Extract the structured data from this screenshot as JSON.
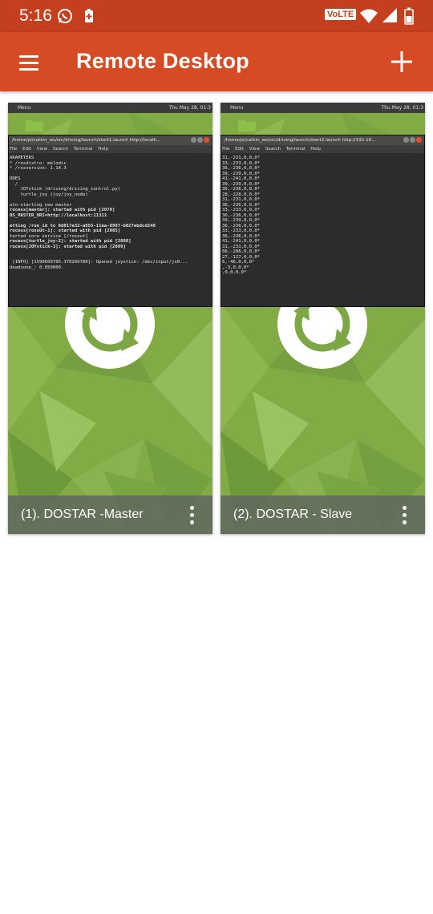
{
  "status_bar": {
    "time": "5:16",
    "icons": [
      "whatsapp-icon",
      "battery-saver-icon"
    ],
    "volte": "VoLTE",
    "right_icons": [
      "wifi-icon",
      "signal-icon",
      "battery-icon"
    ]
  },
  "app_bar": {
    "title": "Remote Desktop",
    "menu_icon": "hamburger-menu-icon",
    "add_icon": "plus-icon"
  },
  "desktops": [
    {
      "label": "(1).   DOSTAR -Master",
      "menu_icon": "more-vert-icon",
      "screen": {
        "top_left": "Menu",
        "top_right": "Thu May 28, 01:3",
        "terminal_title": "/home/pi/catkin_ws/src/driving/launch/start1.launch http://localh...",
        "terminal_menu": [
          "File",
          "Edit",
          "View",
          "Search",
          "Terminal",
          "Help"
        ],
        "lines": [
          {
            "t": "ARAMETERS",
            "s": ""
          },
          {
            "t": "* /rosdistro: melodic",
            "s": ""
          },
          {
            "t": "* /rosversion: 1.14.3",
            "s": ""
          },
          {
            "t": "",
            "s": ""
          },
          {
            "t": "ODES",
            "s": ""
          },
          {
            "t": "  /",
            "s": ""
          },
          {
            "t": "    JOYstick (driving/driving_control.py)",
            "s": ""
          },
          {
            "t": "    turtle_joy (joy/joy_node)",
            "s": ""
          },
          {
            "t": "",
            "s": ""
          },
          {
            "t": "uto-starting new master",
            "s": ""
          },
          {
            "t": "rocess[master]: started with pid [2070]",
            "s": "b"
          },
          {
            "t": "OS_MASTER_URI=http://localhost:11311",
            "s": "b"
          },
          {
            "t": "",
            "s": ""
          },
          {
            "t": "etting /run_id to 0d017e32-a055-11ea-8997-b027ebdcd240",
            "s": "b"
          },
          {
            "t": "rocess[rosout-1]: started with pid [2085]",
            "s": "b"
          },
          {
            "t": "tarted core service [/rosout]",
            "s": ""
          },
          {
            "t": "rocess[turtle_joy-2]: started with pid [2088]",
            "s": "b"
          },
          {
            "t": "rocess[JOYstick-3]: started with pid [2089]",
            "s": "b"
          },
          {
            "t": "",
            "s": "r"
          },
          {
            "t": "",
            "s": "r"
          },
          {
            "t": " [INFO] [1590609785.370266780]: Opened joystick: /dev/input/js0...",
            "s": ""
          },
          {
            "t": "deadzone_: 0.050000.",
            "s": ""
          }
        ]
      }
    },
    {
      "label": "(2).   DOSTAR - Slave",
      "menu_icon": "more-vert-icon",
      "screen": {
        "top_left": "Menu",
        "top_right": "Thu May 28, 01:3",
        "terminal_title": "/home/pi/catkin_ws/src/driving/launch/start2.launch http://192.16...",
        "terminal_menu": [
          "File",
          "Edit",
          "View",
          "Search",
          "Terminal",
          "Help"
        ],
        "lines": [
          {
            "t": "31,-231,0,0,0*",
            "s": ""
          },
          {
            "t": "33,-233,0,0,0*",
            "s": ""
          },
          {
            "t": "36,-236,0,0,0*",
            "s": ""
          },
          {
            "t": "39,-239,0,0,0*",
            "s": ""
          },
          {
            "t": "41,-241,0,0,0*",
            "s": ""
          },
          {
            "t": "39,-239,0,0,0*",
            "s": ""
          },
          {
            "t": "36,-236,0,0,0*",
            "s": ""
          },
          {
            "t": "28,-228,0,0,0*",
            "s": ""
          },
          {
            "t": "31,-231,0,0,0*",
            "s": ""
          },
          {
            "t": "36,-236,0,0,0*",
            "s": ""
          },
          {
            "t": "33,-233,0,0,0*",
            "s": ""
          },
          {
            "t": "36,-236,0,0,0*",
            "s": ""
          },
          {
            "t": "39,-239,0,0,0*",
            "s": ""
          },
          {
            "t": "36,-236,0,0,0*",
            "s": ""
          },
          {
            "t": "33,-233,0,0,0*",
            "s": ""
          },
          {
            "t": "36,-236,0,0,0*",
            "s": ""
          },
          {
            "t": "41,-241,0,0,0*",
            "s": ""
          },
          {
            "t": "31,-231,0,0,0*",
            "s": ""
          },
          {
            "t": "06,-206,0,0,0*",
            "s": ""
          },
          {
            "t": "27,-127,0,0,0*",
            "s": ""
          },
          {
            "t": "6,-46,0,0,0*",
            "s": ""
          },
          {
            "t": ",-3,0,0,0*",
            "s": ""
          },
          {
            "t": ",0,0,0,0*",
            "s": ""
          }
        ]
      }
    }
  ]
}
